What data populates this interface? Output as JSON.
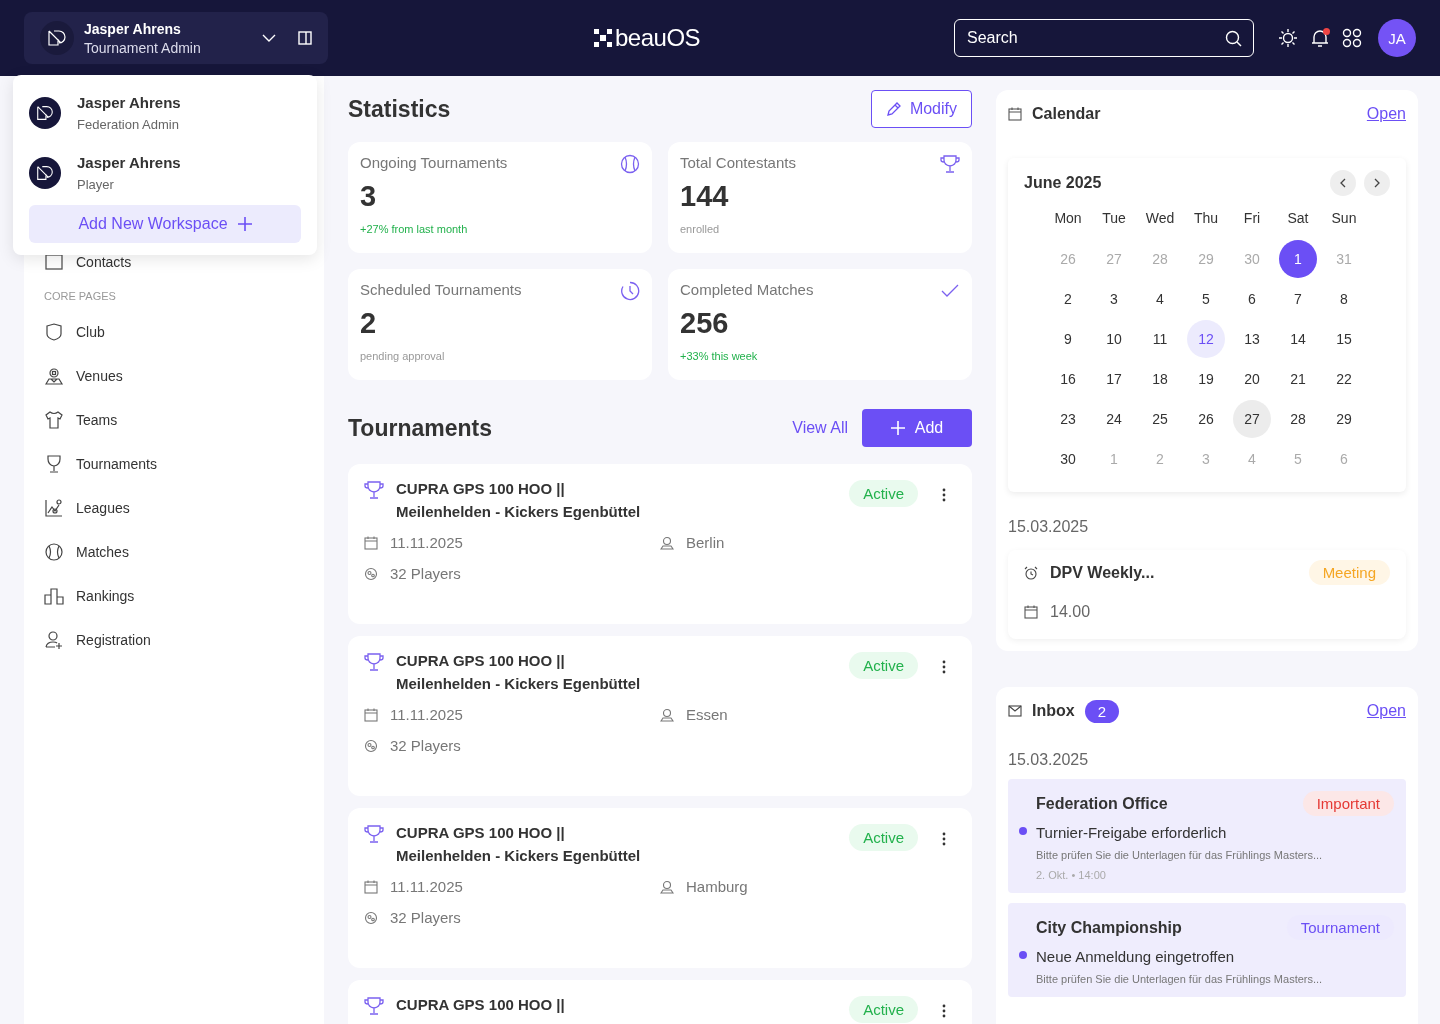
{
  "header": {
    "workspace": {
      "name": "Jasper Ahrens",
      "role": "Tournament Admin"
    },
    "logo": "beauOS",
    "search": {
      "placeholder": "Search"
    },
    "notification_dot": true,
    "avatar": "JA"
  },
  "workspace_menu": {
    "items": [
      {
        "name": "Jasper Ahrens",
        "role": "Federation Admin"
      },
      {
        "name": "Jasper Ahrens",
        "role": "Player"
      }
    ],
    "add_button": "Add New Workspace"
  },
  "sidebar": {
    "partial_item": "Contacts",
    "section": "CORE PAGES",
    "items": [
      {
        "label": "Club"
      },
      {
        "label": "Venues"
      },
      {
        "label": "Teams"
      },
      {
        "label": "Tournaments"
      },
      {
        "label": "Leagues"
      },
      {
        "label": "Matches"
      },
      {
        "label": "Rankings"
      },
      {
        "label": "Registration"
      }
    ]
  },
  "statistics": {
    "title": "Statistics",
    "modify_button": "Modify",
    "cards": [
      {
        "label": "Ongoing Tournaments",
        "value": "3",
        "note": "+27% from last month",
        "positive": true
      },
      {
        "label": "Total Contestants",
        "value": "144",
        "note": "enrolled",
        "positive": false
      },
      {
        "label": "Scheduled Tournaments",
        "value": "2",
        "note": "pending approval",
        "positive": false
      },
      {
        "label": "Completed Matches",
        "value": "256",
        "note": "+33% this week",
        "positive": true
      }
    ]
  },
  "tournaments": {
    "title": "Tournaments",
    "view_all": "View All",
    "add_button": "Add",
    "items": [
      {
        "name": "CUPRA GPS 100 HOO ||",
        "match": "Meilenhelden - Kickers Egenbüttel",
        "status": "Active",
        "date": "11.11.2025",
        "city": "Berlin",
        "players": "32 Players"
      },
      {
        "name": "CUPRA GPS 100 HOO ||",
        "match": "Meilenhelden - Kickers Egenbüttel",
        "status": "Active",
        "date": "11.11.2025",
        "city": "Essen",
        "players": "32 Players"
      },
      {
        "name": "CUPRA GPS 100 HOO ||",
        "match": "Meilenhelden - Kickers Egenbüttel",
        "status": "Active",
        "date": "11.11.2025",
        "city": "Hamburg",
        "players": "32 Players"
      },
      {
        "name": "CUPRA GPS 100 HOO ||",
        "status": "Active"
      }
    ]
  },
  "calendar": {
    "title": "Calendar",
    "open_link": "Open",
    "month": "June 2025",
    "weekdays": [
      "Mon",
      "Tue",
      "Wed",
      "Thu",
      "Fri",
      "Sat",
      "Sun"
    ],
    "days": [
      {
        "label": "26",
        "outside": true,
        "selected": false,
        "today": false,
        "hover": false
      },
      {
        "label": "27",
        "outside": true,
        "selected": false,
        "today": false,
        "hover": false
      },
      {
        "label": "28",
        "outside": true,
        "selected": false,
        "today": false,
        "hover": false
      },
      {
        "label": "29",
        "outside": true,
        "selected": false,
        "today": false,
        "hover": false
      },
      {
        "label": "30",
        "outside": true,
        "selected": false,
        "today": false,
        "hover": false
      },
      {
        "label": "1",
        "outside": false,
        "selected": true,
        "today": false,
        "hover": false
      },
      {
        "label": "31",
        "outside": true,
        "selected": false,
        "today": false,
        "hover": false
      },
      {
        "label": "2",
        "outside": false,
        "selected": false,
        "today": false,
        "hover": false
      },
      {
        "label": "3",
        "outside": false,
        "selected": false,
        "today": false,
        "hover": false
      },
      {
        "label": "4",
        "outside": false,
        "selected": false,
        "today": false,
        "hover": false
      },
      {
        "label": "5",
        "outside": false,
        "selected": false,
        "today": false,
        "hover": false
      },
      {
        "label": "6",
        "outside": false,
        "selected": false,
        "today": false,
        "hover": false
      },
      {
        "label": "7",
        "outside": false,
        "selected": false,
        "today": false,
        "hover": false
      },
      {
        "label": "8",
        "outside": false,
        "selected": false,
        "today": false,
        "hover": false
      },
      {
        "label": "9",
        "outside": false,
        "selected": false,
        "today": false,
        "hover": false
      },
      {
        "label": "10",
        "outside": false,
        "selected": false,
        "today": false,
        "hover": false
      },
      {
        "label": "11",
        "outside": false,
        "selected": false,
        "today": false,
        "hover": false
      },
      {
        "label": "12",
        "outside": false,
        "selected": false,
        "today": true,
        "hover": false
      },
      {
        "label": "13",
        "outside": false,
        "selected": false,
        "today": false,
        "hover": false
      },
      {
        "label": "14",
        "outside": false,
        "selected": false,
        "today": false,
        "hover": false
      },
      {
        "label": "15",
        "outside": false,
        "selected": false,
        "today": false,
        "hover": false
      },
      {
        "label": "16",
        "outside": false,
        "selected": false,
        "today": false,
        "hover": false
      },
      {
        "label": "17",
        "outside": false,
        "selected": false,
        "today": false,
        "hover": false
      },
      {
        "label": "18",
        "outside": false,
        "selected": false,
        "today": false,
        "hover": false
      },
      {
        "label": "19",
        "outside": false,
        "selected": false,
        "today": false,
        "hover": false
      },
      {
        "label": "20",
        "outside": false,
        "selected": false,
        "today": false,
        "hover": false
      },
      {
        "label": "21",
        "outside": false,
        "selected": false,
        "today": false,
        "hover": false
      },
      {
        "label": "22",
        "outside": false,
        "selected": false,
        "today": false,
        "hover": false
      },
      {
        "label": "23",
        "outside": false,
        "selected": false,
        "today": false,
        "hover": false
      },
      {
        "label": "24",
        "outside": false,
        "selected": false,
        "today": false,
        "hover": false
      },
      {
        "label": "25",
        "outside": false,
        "selected": false,
        "today": false,
        "hover": false
      },
      {
        "label": "26",
        "outside": false,
        "selected": false,
        "today": false,
        "hover": false
      },
      {
        "label": "27",
        "outside": false,
        "selected": false,
        "today": false,
        "hover": true
      },
      {
        "label": "28",
        "outside": false,
        "selected": false,
        "today": false,
        "hover": false
      },
      {
        "label": "29",
        "outside": false,
        "selected": false,
        "today": false,
        "hover": false
      },
      {
        "label": "30",
        "outside": false,
        "selected": false,
        "today": false,
        "hover": false
      },
      {
        "label": "1",
        "outside": true,
        "selected": false,
        "today": false,
        "hover": false
      },
      {
        "label": "2",
        "outside": true,
        "selected": false,
        "today": false,
        "hover": false
      },
      {
        "label": "3",
        "outside": true,
        "selected": false,
        "today": false,
        "hover": false
      },
      {
        "label": "4",
        "outside": true,
        "selected": false,
        "today": false,
        "hover": false
      },
      {
        "label": "5",
        "outside": true,
        "selected": false,
        "today": false,
        "hover": false
      },
      {
        "label": "6",
        "outside": true,
        "selected": false,
        "today": false,
        "hover": false
      }
    ],
    "event_date": "15.03.2025",
    "event": {
      "title": "DPV Weekly...",
      "tag": "Meeting",
      "time": "14.00"
    }
  },
  "inbox": {
    "title": "Inbox",
    "count": "2",
    "open_link": "Open",
    "date": "15.03.2025",
    "messages": [
      {
        "sender": "Federation Office",
        "tag": "Important",
        "color": "#e53935",
        "subject": "Turnier-Freigabe erforderlich",
        "preview": "Bitte prüfen Sie die Unterlagen für das Frühlings Masters...",
        "time": "2. Okt. • 14:00",
        "unread": true
      },
      {
        "sender": "City Championship",
        "tag": "Tournament",
        "color": "#6b4ff5",
        "subject": "Neue Anmeldung eingetroffen",
        "preview": "Bitte prüfen Sie die Unterlagen für das Frühlings Masters...",
        "unread": true
      }
    ]
  }
}
